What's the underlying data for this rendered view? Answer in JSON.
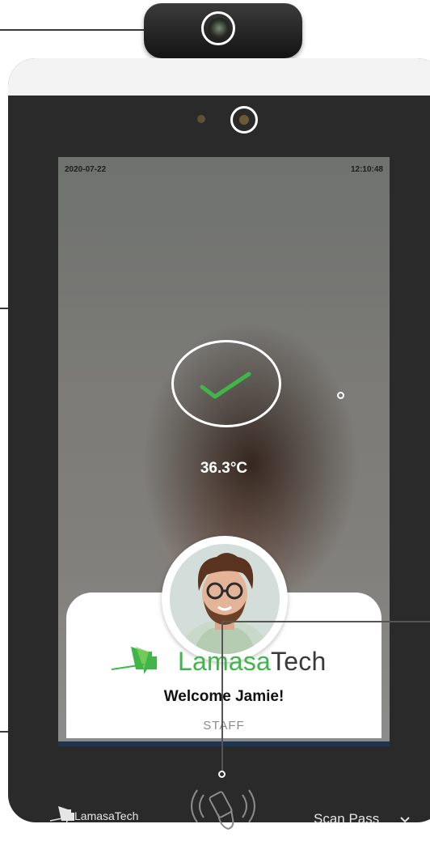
{
  "screen": {
    "date": "2020-07-22",
    "time": "12:10:48",
    "temperature": "36.3°C"
  },
  "card": {
    "brand_prefix": "Lamasa",
    "brand_suffix": "Tech",
    "welcome": "Welcome Jamie!",
    "role": "STAFF"
  },
  "footer": {
    "brand": "LamasaTech",
    "scan_pass_label": "Scan Pass"
  },
  "colors": {
    "accent_green": "#3fb54a",
    "device_body": "#2a2a2a",
    "screen_bar": "#1d3550"
  },
  "icons": [
    "check-icon",
    "nfc-icon",
    "chevron-down-icon",
    "lamasatech-logo"
  ]
}
